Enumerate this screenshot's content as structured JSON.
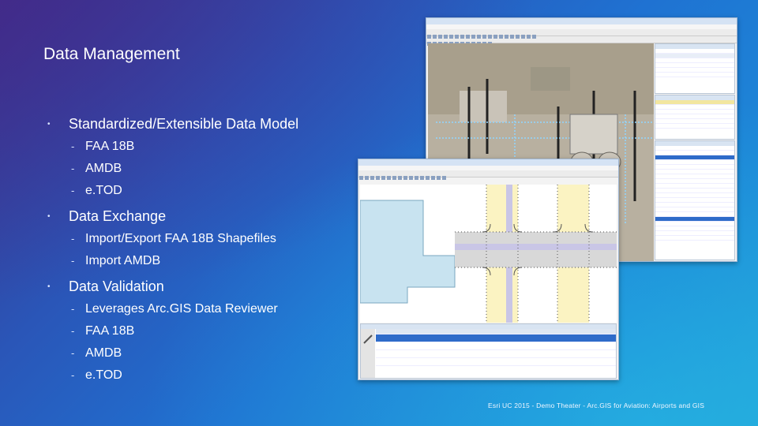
{
  "title": "Data Management",
  "glyphs": {
    "dot": "•",
    "dash": "-"
  },
  "sections": [
    {
      "heading": "Standardized/Extensible Data Model",
      "items": [
        "FAA 18B",
        "AMDB",
        "e.TOD"
      ]
    },
    {
      "heading": "Data Exchange",
      "items": [
        "Import/Export FAA 18B Shapefiles",
        "Import AMDB"
      ]
    },
    {
      "heading": "Data Validation",
      "items": [
        "Leverages Arc.GIS Data Reviewer",
        "FAA 18B",
        "AMDB",
        "e.TOD"
      ]
    }
  ],
  "footer": "Esri UC 2015 - Demo Theater - Arc.GIS for Aviation: Airports and GIS"
}
